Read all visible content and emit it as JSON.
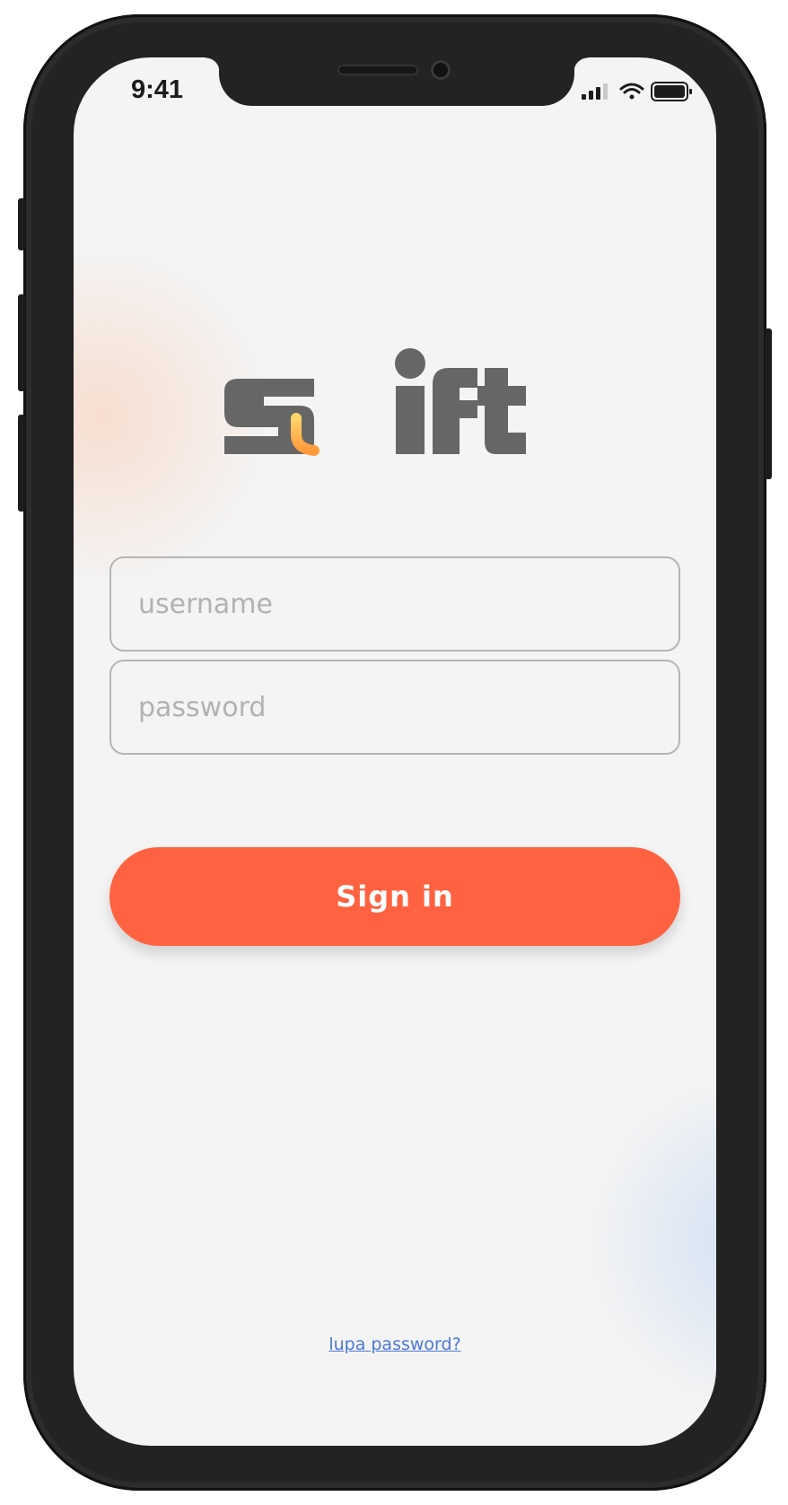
{
  "status_bar": {
    "time": "9:41"
  },
  "logo": {
    "alt": "swift logo"
  },
  "login": {
    "username_placeholder": "username",
    "password_placeholder": "password",
    "sign_in_label": "Sign in",
    "forgot_password_label": "lupa password?"
  },
  "colors": {
    "primary": "#ff6240",
    "link": "#4a78d6",
    "logo_gray": "#666666",
    "logo_orange": "#fdb14a",
    "background": "#f4f4f4"
  },
  "icons": [
    "cellular-signal-icon",
    "wifi-icon",
    "battery-icon"
  ]
}
